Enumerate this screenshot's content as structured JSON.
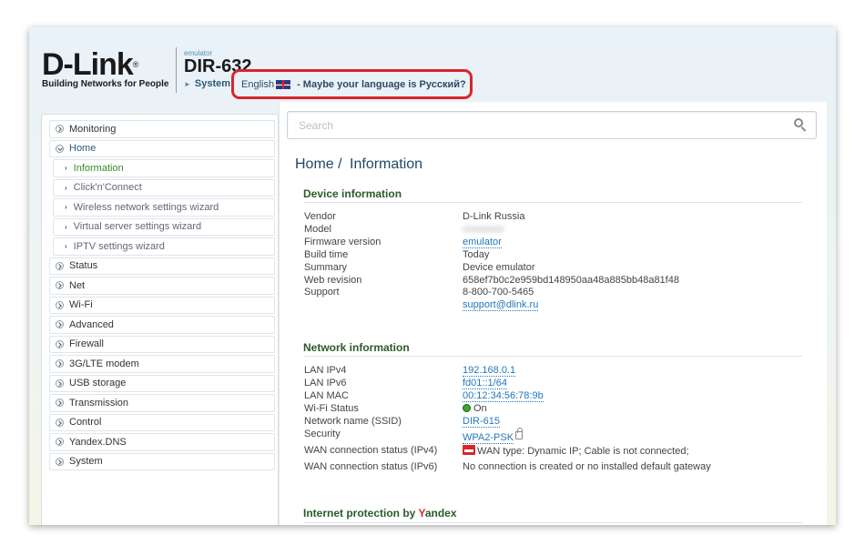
{
  "header": {
    "brand": "D-Link",
    "brand_reg": "®",
    "tagline": "Building Networks for People",
    "model_label": "emulator",
    "model_name": "DIR-632",
    "system_link": "System",
    "language": "English",
    "language_suggest": "- Maybe your language is Русский?",
    "highlight_color": "#d8262b"
  },
  "sidebar": {
    "items": [
      {
        "label": "Monitoring"
      },
      {
        "label": "Home"
      },
      {
        "label": "Information"
      },
      {
        "label": "Click'n'Connect"
      },
      {
        "label": "Wireless network settings wizard"
      },
      {
        "label": "Virtual server settings wizard"
      },
      {
        "label": "IPTV settings wizard"
      },
      {
        "label": "Status"
      },
      {
        "label": "Net"
      },
      {
        "label": "Wi-Fi"
      },
      {
        "label": "Advanced"
      },
      {
        "label": "Firewall"
      },
      {
        "label": "3G/LTE modem"
      },
      {
        "label": "USB storage"
      },
      {
        "label": "Transmission"
      },
      {
        "label": "Control"
      },
      {
        "label": "Yandex.DNS"
      },
      {
        "label": "System"
      }
    ]
  },
  "search": {
    "placeholder": "Search"
  },
  "breadcrumb": {
    "root": "Home /",
    "current": "Information"
  },
  "device_info": {
    "title": "Device information",
    "rows": [
      {
        "key": "Vendor",
        "value": "D-Link Russia"
      },
      {
        "key": "Model",
        "value": ""
      },
      {
        "key": "Firmware version",
        "value": "emulator"
      },
      {
        "key": "Build time",
        "value": "Today"
      },
      {
        "key": "Summary",
        "value": "Device emulator"
      },
      {
        "key": "Web revision",
        "value": "658ef7b0c2e959bd148950aa48a885bb48a81f48"
      },
      {
        "key": "Support",
        "value": "8-800-700-5465"
      },
      {
        "key": "",
        "value": "support@dlink.ru"
      }
    ]
  },
  "network_info": {
    "title": "Network information",
    "rows": [
      {
        "key": "LAN IPv4",
        "value": "192.168.0.1"
      },
      {
        "key": "LAN IPv6",
        "value": "fd01::1/64"
      },
      {
        "key": "LAN MAC",
        "value": "00:12:34:56:78:9b"
      },
      {
        "key": "Wi-Fi Status",
        "value": "On"
      },
      {
        "key": "Network name (SSID)",
        "value": "DIR-615"
      },
      {
        "key": "Security",
        "value": "WPA2-PSK"
      },
      {
        "key": "WAN connection status (IPv4)",
        "value": "WAN type: Dynamic IP; Cable is not connected;"
      },
      {
        "key": "WAN connection status (IPv6)",
        "value": "No connection is created or no installed default gateway"
      }
    ]
  },
  "yandex_section": {
    "title_prefix": "Internet protection by ",
    "title_y": "Y",
    "title_rest": "andex"
  }
}
